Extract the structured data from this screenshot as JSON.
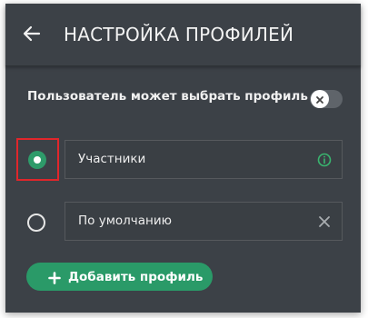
{
  "header": {
    "back_icon": "arrow-left-icon",
    "title": "НАСТРОЙКА ПРОФИЛЕЙ"
  },
  "user_choice": {
    "label": "Пользователь может выбрать профиль",
    "toggle_state": "off",
    "toggle_icon": "close-icon"
  },
  "profiles": [
    {
      "name": "Участники",
      "selected": true,
      "icon": "info-icon"
    },
    {
      "name": "По умолчанию",
      "selected": false,
      "icon": "close-icon"
    }
  ],
  "add_button": {
    "label": "Добавить профиль",
    "icon": "plus-icon"
  },
  "colors": {
    "panel_bg": "#3c4147",
    "accent_green": "#2a9a68",
    "highlight_red": "#e0262b"
  }
}
